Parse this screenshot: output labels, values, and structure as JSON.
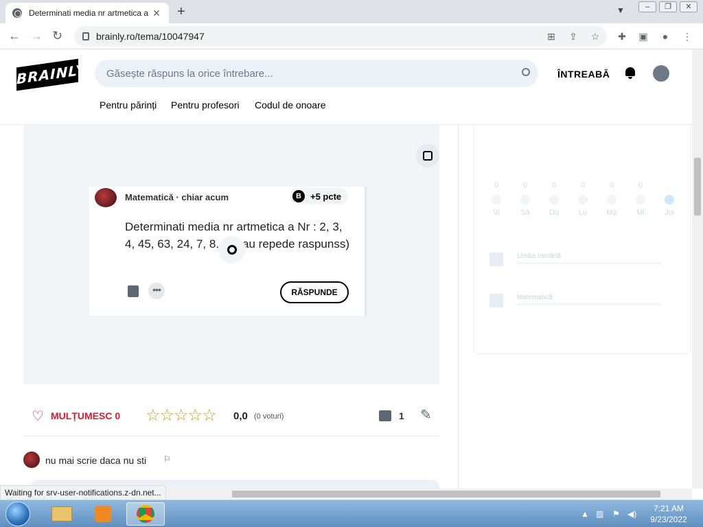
{
  "browser": {
    "tab_title": "Determinati media nr artmetica a",
    "tab_close": "✕",
    "new_tab": "+",
    "url": "brainly.ro/tema/10047947",
    "status": "Waiting for srv-user-notifications.z-dn.net...",
    "window_buttons": [
      "–",
      "❐",
      "✕"
    ]
  },
  "header": {
    "logo": "BRAINLY",
    "search_placeholder": "Găsește răspuns la orice întrebare...",
    "ask_label": "ÎNTREABĂ",
    "subnav": [
      "Pentru părinți",
      "Pentru profesori",
      "Codul de onoare"
    ]
  },
  "question": {
    "meta": "Matematică · chiar acum",
    "points_badge": "B",
    "points": "+5 pcte",
    "text": "Determinati media nr artmetica a Nr : 2, 3, 4, 45, 63, 24, 7, 8. (vreau repede raspunss)",
    "answer_button": "RĂSPUNDE"
  },
  "actions": {
    "thanks": "MULȚUMESC 0",
    "stars": "☆☆☆☆☆",
    "rating": "0,0",
    "votes": "(0 voturi)",
    "comment_count": "1"
  },
  "comment": {
    "text": "nu mai scrie daca nu sti"
  },
  "sidebar": {
    "days": [
      {
        "n": "0",
        "d": "Vi"
      },
      {
        "n": "0",
        "d": "Sâ"
      },
      {
        "n": "0",
        "d": "Du"
      },
      {
        "n": "0",
        "d": "Lu"
      },
      {
        "n": "0",
        "d": "Ma"
      },
      {
        "n": "0",
        "d": "Mi"
      },
      {
        "n": "",
        "d": "Joi"
      }
    ],
    "subjects": [
      "Limba română",
      "Matematică"
    ]
  },
  "taskbar": {
    "time": "7:21 AM",
    "date": "9/23/2022"
  }
}
